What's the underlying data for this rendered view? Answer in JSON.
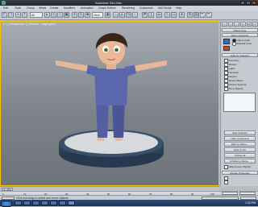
{
  "window": {
    "title": "Autodesk 3ds Max"
  },
  "menubar": {
    "items": [
      "Edit",
      "Tools",
      "Group",
      "Views",
      "Create",
      "Modifiers",
      "Animation",
      "Graph Editors",
      "Rendering",
      "Customize",
      "MAXScript",
      "Help"
    ]
  },
  "toolbar": {
    "filter_label": "All",
    "view_label": "View"
  },
  "viewport": {
    "label": "[ + ] [ Perspective ] [ Smooth + Highlights ]"
  },
  "command_panel": {
    "tabs": [
      "+",
      "~",
      "-",
      "o",
      "D",
      "T"
    ],
    "rollout1": "Object Type",
    "rollout2": "Name and Color",
    "radio_labels": [
      "Object Color",
      "Material Color"
    ],
    "hide_rollout": "Hide by Category",
    "categories": [
      "Geometry",
      "Shapes",
      "Lights",
      "Cameras",
      "Helpers",
      "Space Warps",
      "Particle Systems",
      "Bone Objects"
    ],
    "hide_buttons": [
      "Hide Selected",
      "Hide Unselected",
      "Hide by Name...",
      "Hide by Hit",
      "Unhide All",
      "Unhide by Name...",
      "Hide Frozen Objects"
    ],
    "display_rollout": "Display Properties"
  },
  "timeslider": {
    "frame": "0 / 100"
  },
  "track": {
    "ticks": [
      "0",
      "10",
      "20",
      "30",
      "40",
      "50",
      "60",
      "70",
      "80",
      "90",
      "100"
    ]
  },
  "status": {
    "prompt": "Click and drag to select and move objects"
  },
  "taskbar": {
    "clock": "1:43 PM"
  }
}
